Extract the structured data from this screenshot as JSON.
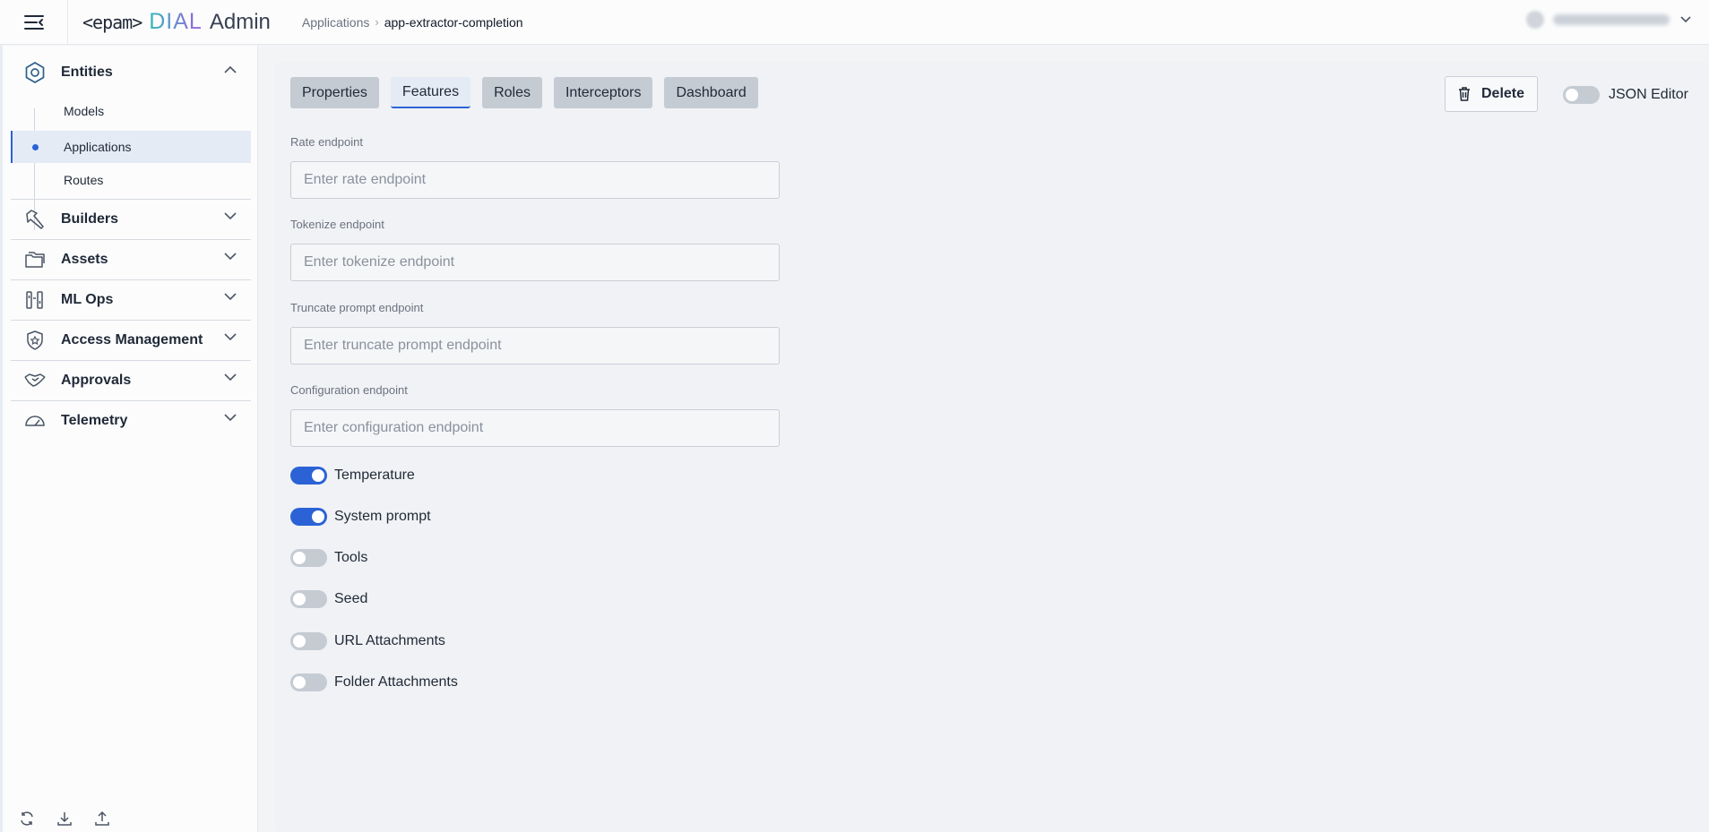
{
  "header": {
    "brand_epam": "<epam>",
    "brand_dial": "DIAL",
    "brand_admin": "Admin",
    "breadcrumb": {
      "parent": "Applications",
      "current": "app-extractor-completion"
    }
  },
  "sidebar": {
    "groups": [
      {
        "label": "Entities",
        "icon": "hexagon-icon",
        "expanded": true
      },
      {
        "label": "Builders",
        "icon": "hammer-icon"
      },
      {
        "label": "Assets",
        "icon": "folders-icon"
      },
      {
        "label": "ML Ops",
        "icon": "ml-ops-icon"
      },
      {
        "label": "Access Management",
        "icon": "shield-star-icon"
      },
      {
        "label": "Approvals",
        "icon": "handshake-icon"
      },
      {
        "label": "Telemetry",
        "icon": "gauge-icon"
      }
    ],
    "entities_items": [
      {
        "label": "Models"
      },
      {
        "label": "Applications",
        "active": true
      },
      {
        "label": "Routes"
      }
    ],
    "footer_icons": [
      "refresh-icon",
      "download-icon",
      "upload-icon"
    ]
  },
  "main": {
    "tabs": [
      {
        "label": "Properties"
      },
      {
        "label": "Features",
        "active": true
      },
      {
        "label": "Roles"
      },
      {
        "label": "Interceptors"
      },
      {
        "label": "Dashboard"
      }
    ],
    "delete_label": "Delete",
    "json_editor_label": "JSON Editor",
    "json_editor_on": false,
    "fields": [
      {
        "label": "Rate endpoint",
        "placeholder": "Enter rate endpoint",
        "value": ""
      },
      {
        "label": "Tokenize endpoint",
        "placeholder": "Enter tokenize endpoint",
        "value": ""
      },
      {
        "label": "Truncate prompt endpoint",
        "placeholder": "Enter truncate prompt endpoint",
        "value": ""
      },
      {
        "label": "Configuration endpoint",
        "placeholder": "Enter configuration endpoint",
        "value": ""
      }
    ],
    "switches": [
      {
        "label": "Temperature",
        "on": true
      },
      {
        "label": "System prompt",
        "on": true
      },
      {
        "label": "Tools",
        "on": false
      },
      {
        "label": "Seed",
        "on": false
      },
      {
        "label": "URL Attachments",
        "on": false
      },
      {
        "label": "Folder Attachments",
        "on": false
      }
    ]
  },
  "colors": {
    "accent": "#2b63d6",
    "tab_bg": "#c5cbd3",
    "active_bg": "#e4ebf5",
    "dial_teal": "#2fb8b8",
    "dial_purple": "#a060e0"
  }
}
